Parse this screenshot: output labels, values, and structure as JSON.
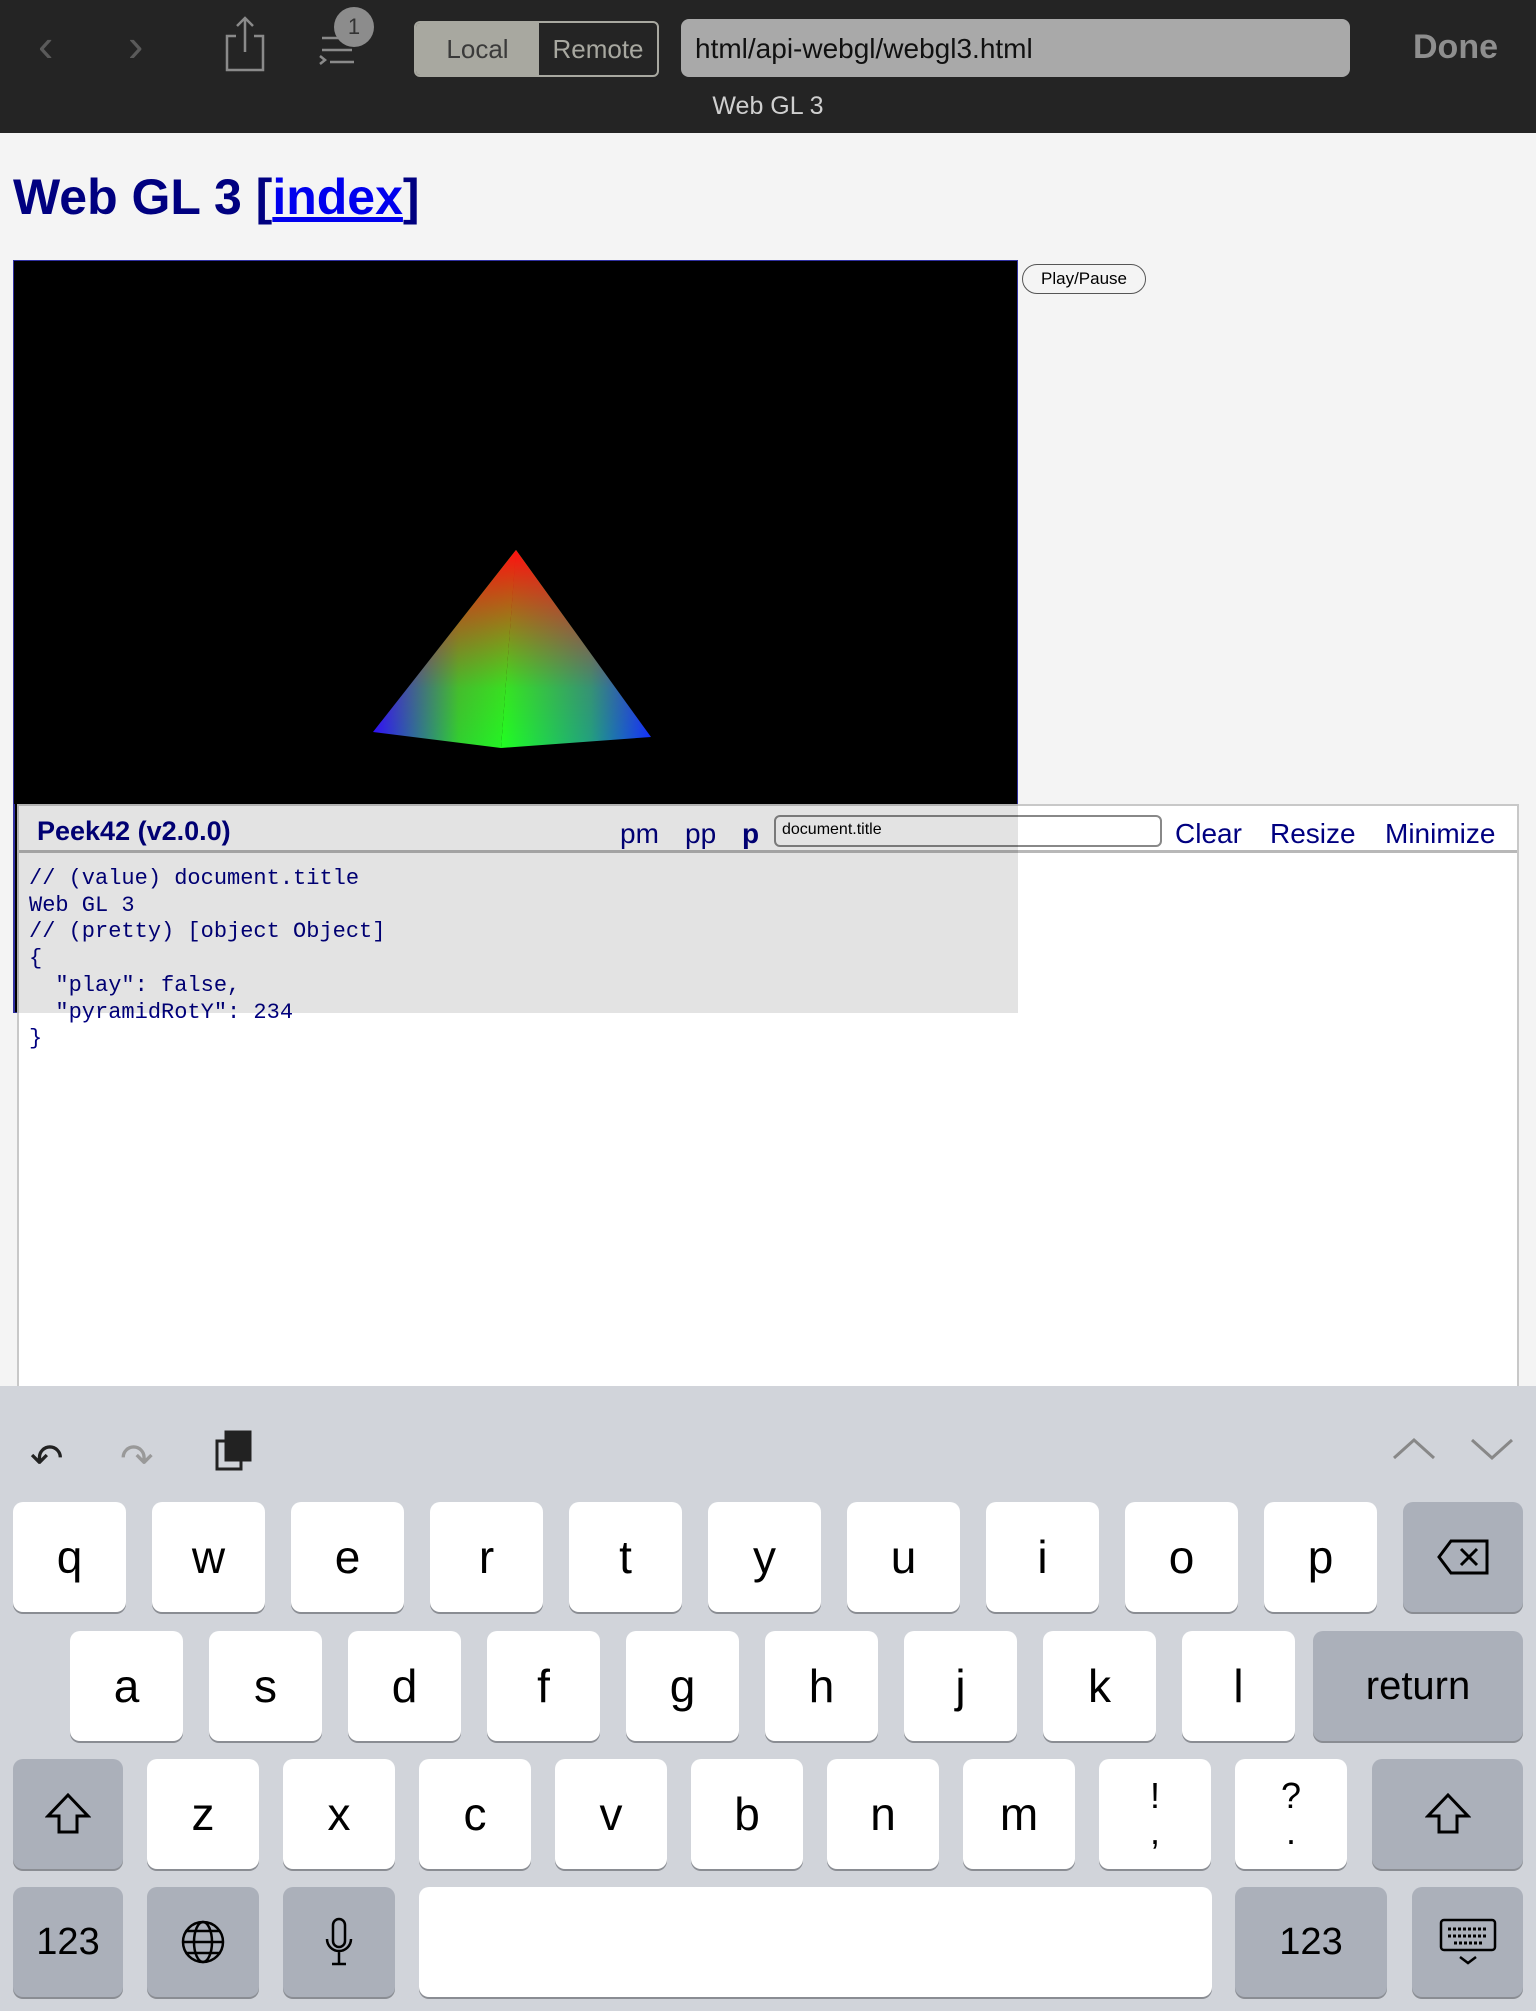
{
  "browser": {
    "tab_count": "1",
    "segments": [
      "Local",
      "Remote"
    ],
    "selected_segment": "Local",
    "url": "html/api-webgl/webgl3.html",
    "done_label": "Done",
    "page_title": "Web GL 3"
  },
  "page": {
    "heading": "Web GL 3",
    "index_link": "index",
    "bracket_open": "[",
    "bracket_close": "]",
    "play_pause_label": "Play/Pause"
  },
  "peek": {
    "title": "Peek42 (v2.0.0)",
    "links": [
      "pm",
      "pp",
      "p"
    ],
    "input_value": "document.title",
    "clear": "Clear",
    "resize": "Resize",
    "minimize": "Minimize",
    "output": "// (value) document.title\nWeb GL 3\n// (pretty) [object Object]\n{\n  \"play\": false,\n  \"pyramidRotY\": 234\n}"
  },
  "keyboard": {
    "row1": [
      "q",
      "w",
      "e",
      "r",
      "t",
      "y",
      "u",
      "i",
      "o",
      "p"
    ],
    "row2": [
      "a",
      "s",
      "d",
      "f",
      "g",
      "h",
      "j",
      "k",
      "l"
    ],
    "return": "return",
    "row3": [
      "z",
      "x",
      "c",
      "v",
      "b",
      "n",
      "m",
      "!\n,",
      "?\n."
    ],
    "numbers": "123"
  }
}
